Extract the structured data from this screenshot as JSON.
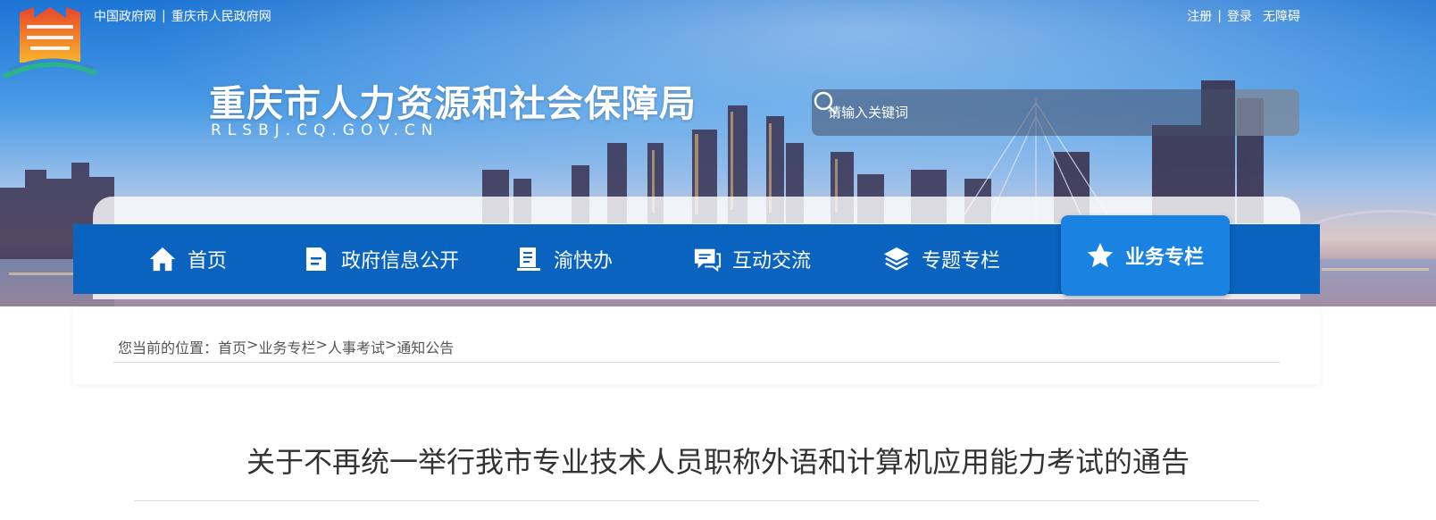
{
  "header": {
    "left_links": [
      "中国政府网",
      "重庆市人民政府网"
    ],
    "right_links": [
      "注册",
      "登录",
      "无障碍"
    ],
    "separator": "|",
    "title": "重庆市人力资源和社会保障局",
    "domain": "RLSBJ.CQ.GOV.CN"
  },
  "search": {
    "placeholder": "请输入关键词",
    "icon": "search-icon"
  },
  "nav": {
    "items": [
      {
        "label": "首页",
        "icon": "home-icon"
      },
      {
        "label": "政府信息公开",
        "icon": "document-icon"
      },
      {
        "label": "渝快办",
        "icon": "book-icon"
      },
      {
        "label": "互动交流",
        "icon": "chat-icon"
      },
      {
        "label": "专题专栏",
        "icon": "layers-icon"
      },
      {
        "label": "业务专栏",
        "icon": "star-icon",
        "active": true
      }
    ]
  },
  "breadcrumb": {
    "prefix": "您当前的位置：",
    "items": [
      "首页",
      "业务专栏",
      "人事考试",
      "通知公告"
    ],
    "separator": ">"
  },
  "article": {
    "title": "关于不再统一举行我市专业技术人员职称外语和计算机应用能力考试的通告"
  },
  "colors": {
    "nav_bg": "#0a63bf",
    "nav_active": "#1a82e0"
  }
}
